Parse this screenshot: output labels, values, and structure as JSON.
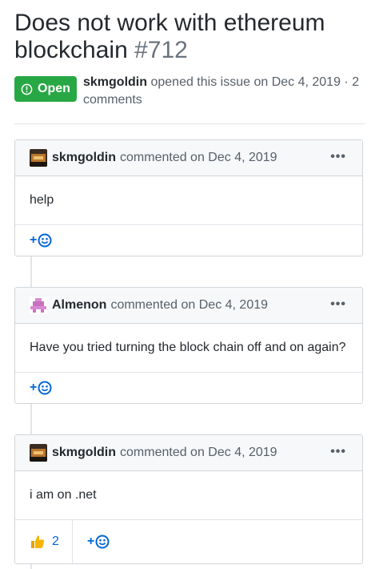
{
  "issue": {
    "title": "Does not work with ethereum blockchain",
    "number": "#712",
    "status_label": "Open",
    "opener": "skmgoldin",
    "opened_text": "opened this issue on Dec 4, 2019 · 2 comments"
  },
  "comments": [
    {
      "author": "skmgoldin",
      "meta": "commented on Dec 4, 2019",
      "body": "help",
      "menu": "•••",
      "add_reaction": "+"
    },
    {
      "author": "Almenon",
      "meta": "commented on Dec 4, 2019",
      "body": "Have you tried turning the block chain off and on again?",
      "menu": "•••",
      "add_reaction": "+"
    },
    {
      "author": "skmgoldin",
      "meta": "commented on Dec 4, 2019",
      "body": "i am on .net",
      "menu": "•••",
      "add_reaction": "+",
      "thumbs_up_count": "2"
    }
  ],
  "colors": {
    "open_green": "#28a745",
    "link_blue": "#0366d6",
    "thumb_yellow": "#f5b400"
  },
  "icons": [
    "issue-opened-icon",
    "avatar",
    "kebab-icon",
    "smiley-icon",
    "thumbs-up-icon"
  ]
}
